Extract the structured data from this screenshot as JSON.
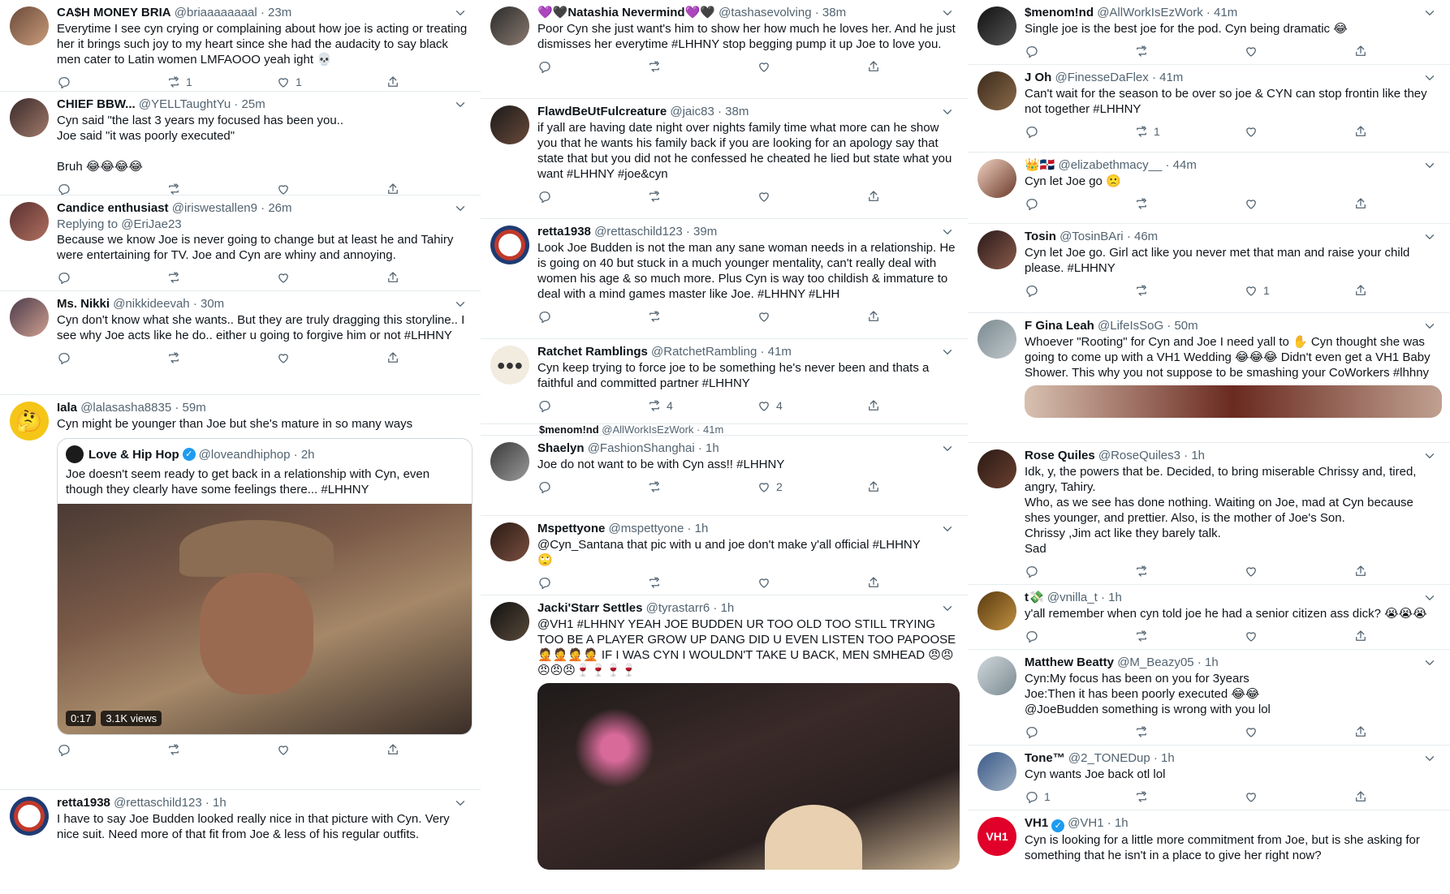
{
  "tweets": [
    {
      "name": "CA$H MONEY BRIA",
      "handle": "@briaaaaaaaal",
      "time": "· 23m",
      "text": "Everytime I see cyn crying or complaining about how joe is acting or treating her it brings such joy to my heart since she had the audacity to say black men cater to Latin women LMFAOOO yeah ight 💀",
      "reply": "",
      "retweet": "1",
      "like": "1"
    },
    {
      "name": "CHIEF BBW...",
      "handle": "@YELLTaughtYu",
      "time": "· 25m",
      "text": "Cyn said \"the last 3 years my focused has been you..\nJoe said \"it was poorly executed\"\n\nBruh 😂😂😂😂",
      "reply": "",
      "retweet": "",
      "like": ""
    },
    {
      "name": "Candice enthusiast",
      "handle": "@iriswestallen9",
      "time": "· 26m",
      "replying_to": "Replying to @EriJae23",
      "text": "Because we know Joe is never going to change but at least he and Tahiry were entertaining for TV. Joe and Cyn are whiny and annoying.",
      "reply": "",
      "retweet": "",
      "like": ""
    },
    {
      "name": "Ms. Nikki",
      "handle": "@nikkideevah",
      "time": "· 30m",
      "text": "Cyn don't know what she wants.. But they are truly dragging this storyline.. I see why Joe acts like he do.. either u going to forgive him or not #LHHNY",
      "reply": "",
      "retweet": "",
      "like": ""
    },
    {
      "name": "Iala",
      "handle": "@lalasasha8835",
      "time": "· 59m",
      "text": "Cyn might be younger than Joe but she's mature in so many ways",
      "quote": {
        "name": "Love & Hip Hop",
        "handle": "@loveandhiphop",
        "time": "· 2h",
        "text": "Joe doesn't seem ready to get back in a relationship with Cyn, even though they clearly have some feelings there... #LHHNY",
        "duration": "0:17",
        "views": "3.1K views"
      },
      "reply": "",
      "retweet": "",
      "like": ""
    },
    {
      "name": "retta1938",
      "handle": "@rettaschild123",
      "time": "· 1h",
      "text": "I have to say Joe Budden looked really nice in that picture with Cyn.  Very nice suit.  Need more of that fit from Joe & less of his regular outfits.",
      "reply": "",
      "retweet": "",
      "like": ""
    },
    {
      "name": "💜🖤Natashia Nevermind💜🖤",
      "handle": "@tashasevolving",
      "time": "· 38m",
      "text": "Poor Cyn she just want's him to show her how much he loves her. And he just dismisses her everytime #LHHNY stop begging pump it up Joe to love you.",
      "reply": "",
      "retweet": "",
      "like": ""
    },
    {
      "name": "FlawdBeUtFulcreature",
      "handle": "@jaic83",
      "time": "· 38m",
      "text": "if yall are having date night over nights family time what more can he show you that he wants his family back if you are looking for an apology say that state that but you did not he confessed he cheated he lied but state what you want #LHHNY #joe&cyn",
      "reply": "",
      "retweet": "",
      "like": ""
    },
    {
      "name": "retta1938",
      "handle": "@rettaschild123",
      "time": "· 39m",
      "text": "Look Joe Budden is not the man any sane woman needs in a relationship. He is going on 40 but stuck in a much younger mentality, can't really deal with women his age & so much more.  Plus Cyn is way too childish & immature to deal with a mind games master like Joe.  #LHHNY #LHH",
      "reply": "",
      "retweet": "",
      "like": ""
    },
    {
      "name": "Ratchet Ramblings",
      "handle": "@RatchetRambling",
      "time": "· 41m",
      "text": "Cyn keep trying to force joe to be something he's never been and thats a faithful and committed partner #LHHNY",
      "reply": "",
      "retweet": "4",
      "like": "4"
    },
    {
      "name": "$menom!nd",
      "handle": "@AllWorkIsEzWork",
      "time": "· 41m",
      "text": "",
      "reply": "",
      "retweet": "",
      "like": ""
    },
    {
      "name": "Shaelyn",
      "handle": "@FashionShanghai",
      "time": "· 1h",
      "text": "Joe do not want to be with Cyn ass!! #LHHNY",
      "reply": "",
      "retweet": "",
      "like": "2"
    },
    {
      "name": "Mspettyone",
      "handle": "@mspettyone",
      "time": "· 1h",
      "text": "@Cyn_Santana that pic with u and joe don't make y'all official #LHHNY\n🙄",
      "reply": "",
      "retweet": "",
      "like": ""
    },
    {
      "name": "Jacki'Starr Settles",
      "handle": "@tyrastarr6",
      "time": "· 1h",
      "text": "@VH1 #LHHNY YEAH JOE BUDDEN UR TOO OLD TOO STILL TRYING TOO BE A PLAYER GROW UP DANG DID U EVEN LISTEN TOO PAPOOSE 🤦🤦🤦🤦 IF I WAS CYN I WOULDN'T TAKE U BACK, MEN SMHEAD 😠😠😠😠😠🍷🍷🍷🍷",
      "reply": "",
      "retweet": "",
      "like": ""
    },
    {
      "name": "$menom!nd",
      "handle": "@AllWorkIsEzWork",
      "time": "· 41m",
      "text": "Single joe is the best joe for the pod. Cyn being dramatic 😂",
      "reply": "",
      "retweet": "",
      "like": ""
    },
    {
      "name": "J Oh",
      "handle": "@FinesseDaFlex",
      "time": "· 41m",
      "text": "Can't wait for the season to be over so joe & CYN can stop frontin like they not together #LHHNY",
      "reply": "",
      "retweet": "1",
      "like": ""
    },
    {
      "name": "👑🇩🇴",
      "handle": "@elizabethmacy__",
      "time": "· 44m",
      "text": "Cyn let Joe go 🙁",
      "reply": "",
      "retweet": "",
      "like": ""
    },
    {
      "name": "Tosin",
      "handle": "@TosinBAri",
      "time": "· 46m",
      "text": "Cyn let Joe go. Girl act like you never met that man and raise your child please. #LHHNY",
      "reply": "",
      "retweet": "",
      "like": "1"
    },
    {
      "name": "F Gina Leah",
      "handle": "@LifeIsSoG",
      "time": "· 50m",
      "text": "Whoever \"Rooting\" for Cyn and Joe I need yall to ✋ Cyn thought she was going to come up with a VH1 Wedding 😂😂😂 Didn't even get a VH1 Baby Shower. This why you not suppose to be smashing your CoWorkers #lhhny",
      "reply": "",
      "retweet": "",
      "like": ""
    },
    {
      "name": "Rose Quiles",
      "handle": "@RoseQuiles3",
      "time": "· 1h",
      "text": "Idk, y,  the powers that be.  Decided,  to bring miserable Chrissy and,  tired, angry,  Tahiry.\nWho,  as we see has done nothing. Waiting on Joe,  mad at Cyn because shes younger, and prettier.  Also,  is the mother of Joe's Son.\nChrissy ,Jim act like they barely talk.\nSad",
      "reply": "",
      "retweet": "",
      "like": ""
    },
    {
      "name": "t💸",
      "handle": "@vnilla_t",
      "time": "· 1h",
      "text": "y'all remember when cyn told joe he had a senior citizen ass dick? 😭😭😭",
      "reply": "",
      "retweet": "",
      "like": ""
    },
    {
      "name": "Matthew Beatty",
      "handle": "@M_Beazy05",
      "time": "· 1h",
      "text": "Cyn:My focus has been on you for 3years\nJoe:Then it has been poorly executed 😂😂\n@JoeBudden  something is wrong with you lol",
      "reply": "",
      "retweet": "",
      "like": ""
    },
    {
      "name": "Tone™",
      "handle": "@2_TONEDup",
      "time": "· 1h",
      "text": "Cyn wants Joe back otl lol",
      "reply": "1",
      "retweet": "",
      "like": ""
    },
    {
      "name": "VH1",
      "handle": "@VH1",
      "time": "· 1h",
      "text": "Cyn is looking for a little more commitment from Joe, but is she asking for something that he isn't in a place to give her right now?",
      "reply": "",
      "retweet": "",
      "like": ""
    }
  ],
  "icons": {
    "reply": "reply-icon",
    "retweet": "retweet-icon",
    "like": "like-icon",
    "share": "share-icon",
    "chevron": "chevron-down-icon",
    "verified": "verified-badge-icon"
  },
  "colors": {
    "link": "#1b95e0",
    "text": "#0f1419",
    "muted": "#536471",
    "divider": "#e6ecf0",
    "verified": "#1d9bf0"
  }
}
